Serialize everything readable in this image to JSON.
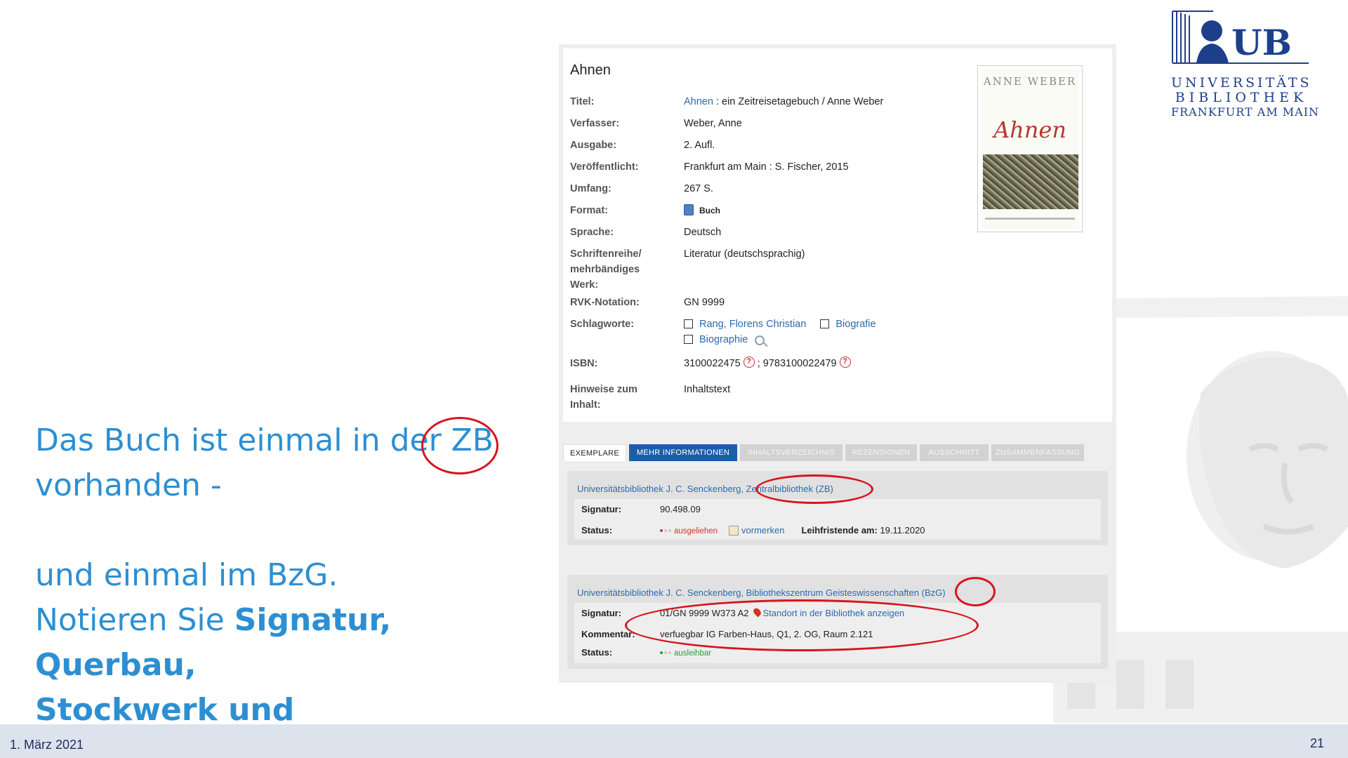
{
  "slide": {
    "line1": "Das Buch ist einmal in der ZB",
    "line2": "vorhanden -",
    "line3": "und einmal im BzG.",
    "line4_prefix": "Notieren Sie ",
    "line4_bold": "Signatur, Querbau,",
    "line5_bold": "Stockwerk und Raumnummer."
  },
  "footer": {
    "date": "1. März 2021",
    "page": "21"
  },
  "logo": {
    "mark_text": "UB",
    "line1": "UNIVERSITÄTS",
    "line2": "BIBLIOTHEK",
    "line3": "FRANKFURT AM MAIN"
  },
  "record": {
    "title": "Ahnen",
    "fields": {
      "titel_label": "Titel:",
      "titel_link": "Ahnen",
      "titel_rest": " : ein Zeitreisetagebuch / Anne Weber",
      "verfasser_label": "Verfasser:",
      "verfasser_value": "Weber, Anne",
      "ausgabe_label": "Ausgabe:",
      "ausgabe_value": "2. Aufl.",
      "veroeff_label": "Veröffentlicht:",
      "veroeff_value": "Frankfurt am Main : S. Fischer, 2015",
      "umfang_label": "Umfang:",
      "umfang_value": "267 S.",
      "format_label": "Format:",
      "format_value": "Buch",
      "sprache_label": "Sprache:",
      "sprache_value": "Deutsch",
      "reihe_label": "Schriftenreihe/ mehrbändiges Werk:",
      "reihe_value": "Literatur (deutschsprachig)",
      "rvk_label": "RVK-Notation:",
      "rvk_value": "GN 9999",
      "schlag_label": "Schlagworte:",
      "schlag_1": "Rang, Florens Christian",
      "schlag_2": "Biografie",
      "schlag_3": "Biographie",
      "isbn_label": "ISBN:",
      "isbn_1": "3100022475",
      "isbn_sep": " ; ",
      "isbn_2": "9783100022479",
      "hinweise_label": "Hinweise zum Inhalt:",
      "hinweise_value": "Inhaltstext"
    },
    "cover": {
      "author": "ANNE WEBER",
      "title": "Ahnen"
    }
  },
  "tabs": [
    "EXEMPLARE",
    "MEHR INFORMATIONEN",
    "INHALTSVERZEICHNIS",
    "REZENSIONEN",
    "AUSSCHNITT",
    "ZUSAMMENFASSUNG"
  ],
  "holdings": [
    {
      "library": "Universitätsbibliothek J. C. Senckenberg, Zentralbibliothek (ZB)",
      "signatur_label": "Signatur:",
      "signatur": "90.498.09",
      "status_label": "Status:",
      "status": "ausgeliehen",
      "vormerken": "vormerken",
      "leihfrist_label": "Leihfristende am:",
      "leihfrist": "19.11.2020"
    },
    {
      "library": "Universitätsbibliothek J. C. Senckenberg, Bibliothekszentrum Geisteswissenschaften (BzG)",
      "signatur_label": "Signatur:",
      "signatur": "01/GN 9999 W373 A2",
      "standort": "Standort in der Bibliothek anzeigen",
      "kommentar_label": "Kommentar:",
      "kommentar": "verfuegbar IG Farben-Haus, Q1, 2. OG, Raum 2.121",
      "status_label": "Status:",
      "status": "ausleihbar"
    }
  ],
  "colors": {
    "slide_blue": "#2d8fd2",
    "marker_red": "#d8141c",
    "link_blue": "#2c6aaa",
    "tab_blue": "#1d5ea8"
  }
}
